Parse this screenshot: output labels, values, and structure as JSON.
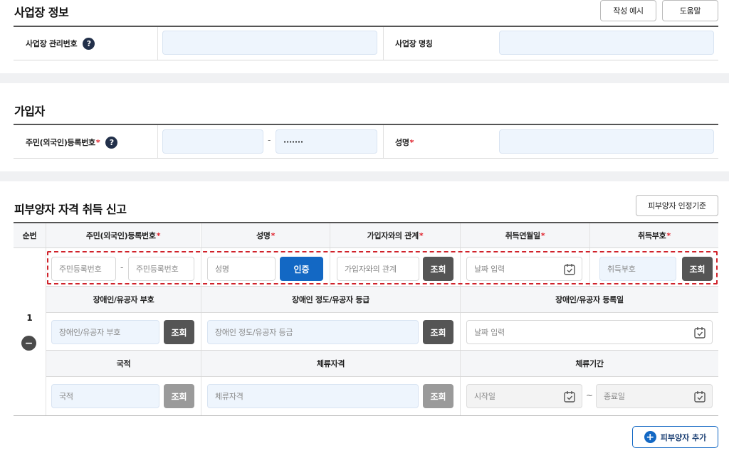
{
  "business": {
    "title": "사업장 정보",
    "example_button": "작성 예시",
    "help_button": "도움말",
    "mgmt_no_label": "사업장 관리번호",
    "name_label": "사업장 명칭",
    "mgmt_no_value": "",
    "name_value": ""
  },
  "subscriber": {
    "title": "가입자",
    "rrn_label": "주민(외국인)등록번호",
    "rrn_front_value": "",
    "rrn_separator": "-",
    "rrn_back_value": "·······",
    "name_label": "성명",
    "name_value": "",
    "required_mark": "*"
  },
  "dependent": {
    "title": "피부양자 자격 취득 신고",
    "criteria_button": "피부양자 인정기준",
    "headers": {
      "seq": "순번",
      "rrn": "주민(외국인)등록번호",
      "name": "성명",
      "relation": "가입자와의 관계",
      "acq_date": "취득연월일",
      "acq_code": "취득부호",
      "disability_code": "장애인/유공자 부호",
      "disability_grade": "장애인 정도/유공자 등급",
      "disability_reg_date": "장애인/유공자 등록일",
      "nationality": "국적",
      "stay_status": "체류자격",
      "stay_period": "체류기간"
    },
    "row": {
      "seq": "1",
      "remove_icon": "minus-circle-icon",
      "rrn_front_placeholder": "주민등록번호",
      "rrn_back_placeholder": "주민등록번호",
      "rrn_separator": "-",
      "name_placeholder": "성명",
      "verify_button": "인증",
      "relation_placeholder": "가입자와의 관계",
      "lookup_button": "조회",
      "acq_date_placeholder": "날짜 입력",
      "acq_code_placeholder": "취득부호",
      "disability_code_placeholder": "장애인/유공자 부호",
      "disability_grade_placeholder": "장애인 정도/유공자 등급",
      "disability_reg_date_placeholder": "날짜 입력",
      "nationality_placeholder": "국적",
      "stay_status_placeholder": "체류자격",
      "stay_start_placeholder": "시작일",
      "stay_end_placeholder": "종료일",
      "range_separator": "~"
    },
    "add_button": "피부양자 추가"
  },
  "colors": {
    "primary": "#1368c4",
    "required": "#e0202a",
    "highlight_dash": "#d0222a",
    "dark_button": "#555555"
  }
}
